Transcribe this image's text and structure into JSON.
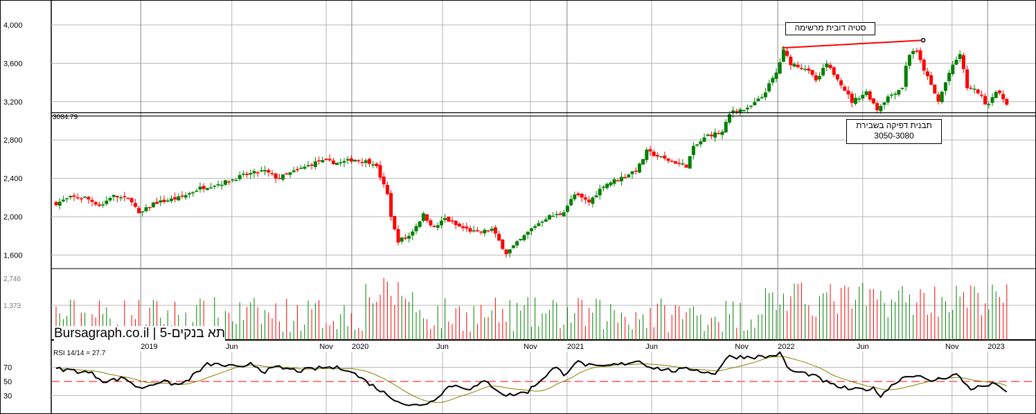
{
  "chart_data": {
    "type": "candlestick",
    "title": "תא בנקים-5",
    "watermark": "Bursagraph.co.il | תא בנקים-5",
    "price_axis": {
      "ticks": [
        1600,
        2000,
        2400,
        2800,
        3200,
        3600,
        4000
      ],
      "tick_labels": [
        "1,600",
        "2,000",
        "2,400",
        "2,800",
        "3,200",
        "3,600",
        "4,000"
      ],
      "ylim": [
        1480,
        4250
      ]
    },
    "x_ticks": [
      {
        "label": "2019",
        "week": 23.5,
        "year": true
      },
      {
        "label": "Jun",
        "week": 48.8
      },
      {
        "label": "Nov",
        "week": 75
      },
      {
        "label": "2020",
        "week": 82.1,
        "year": true
      },
      {
        "label": "Jun",
        "week": 107.3
      },
      {
        "label": "Nov",
        "week": 131.7
      },
      {
        "label": "2021",
        "week": 141.9,
        "year": true
      },
      {
        "label": "Jun",
        "week": 165.4
      },
      {
        "label": "Nov",
        "week": 190.4
      },
      {
        "label": "2022",
        "week": 200.4,
        "year": true
      },
      {
        "label": "Jun",
        "week": 224
      },
      {
        "label": "Nov",
        "week": 248.8
      },
      {
        "label": "2023",
        "week": 258.7,
        "year": true
      }
    ],
    "weekly_close_keypoints": [
      [
        0,
        2140
      ],
      [
        4,
        2200
      ],
      [
        8,
        2200
      ],
      [
        12.5,
        2110
      ],
      [
        15.4,
        2220
      ],
      [
        21,
        2170
      ],
      [
        23,
        2020
      ],
      [
        27,
        2140
      ],
      [
        34.6,
        2200
      ],
      [
        40,
        2300
      ],
      [
        46,
        2350
      ],
      [
        52,
        2430
      ],
      [
        57.7,
        2480
      ],
      [
        61.5,
        2400
      ],
      [
        67.3,
        2490
      ],
      [
        73,
        2580
      ],
      [
        78.8,
        2560
      ],
      [
        82.7,
        2600
      ],
      [
        88.5,
        2560
      ],
      [
        92.3,
        2200
      ],
      [
        93.3,
        1930
      ],
      [
        95,
        1750
      ],
      [
        98,
        1800
      ],
      [
        102,
        2020
      ],
      [
        105,
        1880
      ],
      [
        108,
        1980
      ],
      [
        111.5,
        1900
      ],
      [
        117,
        1830
      ],
      [
        121,
        1870
      ],
      [
        125,
        1620
      ],
      [
        129,
        1760
      ],
      [
        132.7,
        1900
      ],
      [
        136.5,
        2000
      ],
      [
        140.4,
        2030
      ],
      [
        144,
        2230
      ],
      [
        148,
        2150
      ],
      [
        152,
        2330
      ],
      [
        157.7,
        2420
      ],
      [
        161.5,
        2500
      ],
      [
        164,
        2680
      ],
      [
        169,
        2600
      ],
      [
        175,
        2530
      ],
      [
        177,
        2720
      ],
      [
        181,
        2850
      ],
      [
        185,
        2880
      ],
      [
        187.5,
        3110
      ],
      [
        192,
        3120
      ],
      [
        196,
        3250
      ],
      [
        200,
        3500
      ],
      [
        202,
        3730
      ],
      [
        204,
        3600
      ],
      [
        208,
        3550
      ],
      [
        211.5,
        3400
      ],
      [
        213.5,
        3600
      ],
      [
        217,
        3450
      ],
      [
        221,
        3200
      ],
      [
        225,
        3300
      ],
      [
        228,
        3120
      ],
      [
        231,
        3250
      ],
      [
        235,
        3350
      ],
      [
        236.5,
        3680
      ],
      [
        238.5,
        3750
      ],
      [
        242,
        3450
      ],
      [
        245,
        3200
      ],
      [
        248,
        3500
      ],
      [
        251,
        3700
      ],
      [
        253,
        3350
      ],
      [
        256,
        3300
      ],
      [
        258.7,
        3150
      ],
      [
        260.6,
        3320
      ],
      [
        262.5,
        3250
      ],
      [
        264.4,
        3170
      ]
    ],
    "horizontal_lines": [
      {
        "value": 3084.79,
        "label": "3084.79"
      },
      {
        "value": 3050
      }
    ],
    "trendline": {
      "from": {
        "week": 201.5,
        "value": 3760
      },
      "to": {
        "week": 240.8,
        "value": 3840
      },
      "color": "#ff0000"
    },
    "annotations": [
      {
        "text": "סטיה דובית מרשימה"
      },
      {
        "text": "תבנית דפיקה בשבירת",
        "text2": "3050-3080"
      }
    ],
    "volume_axis": {
      "tick_labels": [
        "1,373",
        "2,746"
      ],
      "ticks": [
        1373,
        2746
      ]
    },
    "rsi": {
      "label": "RSI 14/14 = 27.7",
      "ticks": [
        30,
        50,
        70
      ],
      "tick_labels": [
        "30",
        "50",
        "70"
      ],
      "midline": 50,
      "keypoints": [
        [
          0,
          68
        ],
        [
          4,
          66
        ],
        [
          9.6,
          62
        ],
        [
          13.5,
          50
        ],
        [
          19.2,
          55
        ],
        [
          23,
          40
        ],
        [
          28.8,
          50
        ],
        [
          34.6,
          45
        ],
        [
          38.5,
          60
        ],
        [
          42.3,
          75
        ],
        [
          48,
          72
        ],
        [
          51.9,
          68
        ],
        [
          53.8,
          78
        ],
        [
          57.7,
          64
        ],
        [
          61.5,
          70
        ],
        [
          67.3,
          65
        ],
        [
          75,
          70
        ],
        [
          80.8,
          68
        ],
        [
          84.6,
          55
        ],
        [
          92.3,
          30
        ],
        [
          98,
          15
        ],
        [
          103.8,
          20
        ],
        [
          109.6,
          45
        ],
        [
          115.4,
          40
        ],
        [
          119.2,
          50
        ],
        [
          125,
          30
        ],
        [
          130.8,
          35
        ],
        [
          138.5,
          70
        ],
        [
          141.3,
          60
        ],
        [
          144.2,
          78
        ],
        [
          150,
          70
        ],
        [
          157.7,
          75
        ],
        [
          161.5,
          80
        ],
        [
          165.4,
          70
        ],
        [
          171.2,
          65
        ],
        [
          176.9,
          68
        ],
        [
          182.7,
          60
        ],
        [
          186.5,
          85
        ],
        [
          192.3,
          85
        ],
        [
          198,
          85
        ],
        [
          200.9,
          90
        ],
        [
          203.8,
          65
        ],
        [
          209.6,
          60
        ],
        [
          215.4,
          45
        ],
        [
          221.2,
          38
        ],
        [
          226.9,
          40
        ],
        [
          228.8,
          30
        ],
        [
          234.6,
          55
        ],
        [
          238.5,
          60
        ],
        [
          242.3,
          50
        ],
        [
          246.2,
          55
        ],
        [
          250,
          60
        ],
        [
          253.8,
          40
        ],
        [
          259.6,
          45
        ],
        [
          261.5,
          48
        ],
        [
          264.4,
          30
        ]
      ]
    },
    "colors": {
      "up": "#008000",
      "down": "#ff0000",
      "signal": "#808000",
      "rsi": "#000000",
      "grid": "#b4b4b4"
    }
  }
}
